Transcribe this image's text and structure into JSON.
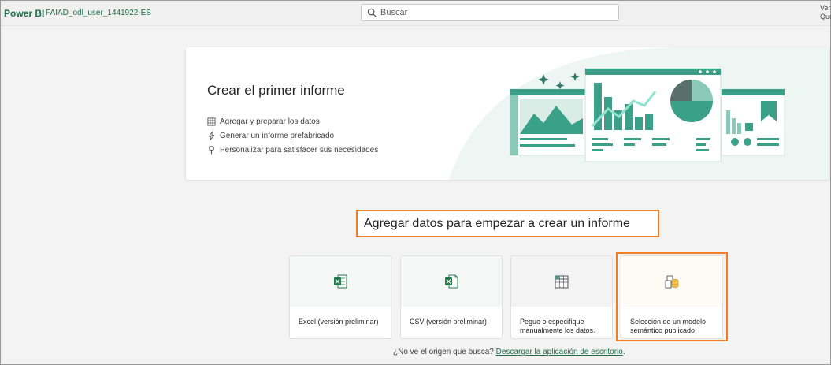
{
  "header": {
    "brand": "Power BI",
    "workspace": "FAIAD_odl_user_1441922-ES",
    "search_placeholder": "Buscar",
    "right_line1": "Ver",
    "right_line2": "Que"
  },
  "hero": {
    "title": "Crear el primer informe",
    "features": [
      {
        "icon": "table-icon",
        "label": "Agregar y preparar los datos"
      },
      {
        "icon": "lightning-icon",
        "label": "Generar un informe prefabricado"
      },
      {
        "icon": "brush-icon",
        "label": "Personalizar para satisfacer sus necesidades"
      }
    ],
    "close_icon": "close-icon"
  },
  "section": {
    "title": "Agregar datos para empezar a crear un informe"
  },
  "sources": [
    {
      "icon": "excel-icon",
      "label": "Excel (versión preliminar)"
    },
    {
      "icon": "csv-icon",
      "label": "CSV (versión preliminar)"
    },
    {
      "icon": "table-paste-icon",
      "label": "Pegue o especifique manualmente los datos."
    },
    {
      "icon": "semantic-model-icon",
      "label": "Selección de un modelo semántico publicado"
    }
  ],
  "footer": {
    "question": "¿No ve el origen que busca?",
    "link": "Descargar la aplicación de escritorio",
    "period": "."
  },
  "colors": {
    "brand_green": "#1f6f4a",
    "accent_teal": "#3aa188",
    "highlight_orange": "#f07e26"
  }
}
